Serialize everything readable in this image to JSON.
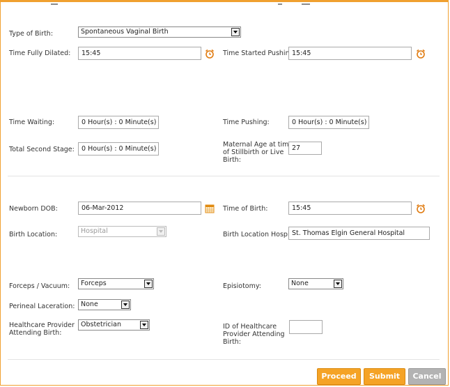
{
  "form": {
    "type_of_birth": {
      "label": "Type of Birth:",
      "value": "Spontaneous Vaginal Birth"
    },
    "time_fully_dilated": {
      "label": "Time Fully Dilated:",
      "value": "15:45"
    },
    "time_started_pushing": {
      "label": "Time Started Pushing:",
      "value": "15:45"
    },
    "time_waiting": {
      "label": "Time Waiting:",
      "value": "0 Hour(s) : 0 Minute(s)"
    },
    "time_pushing": {
      "label": "Time Pushing:",
      "value": "0 Hour(s) : 0 Minute(s)"
    },
    "total_second_stage": {
      "label": "Total Second Stage:",
      "value": "0 Hour(s) : 0 Minute(s)"
    },
    "maternal_age": {
      "label_line1": "Maternal Age at time",
      "label_line2": "of Stillbirth or Live",
      "label_line3": "Birth:",
      "value": "27"
    },
    "newborn_dob": {
      "label": "Newborn DOB:",
      "value": "06-Mar-2012"
    },
    "time_of_birth": {
      "label": "Time of Birth:",
      "value": "15:45"
    },
    "birth_location": {
      "label": "Birth Location:",
      "value": "Hospital"
    },
    "birth_location_hospital": {
      "label": "Birth Location Hospital:",
      "value": "St. Thomas Elgin General Hospital"
    },
    "forceps_vacuum": {
      "label": "Forceps / Vacuum:",
      "value": "Forceps"
    },
    "episiotomy": {
      "label": "Episiotomy:",
      "value": "None"
    },
    "perineal_laceration": {
      "label": "Perineal Laceration:",
      "value": "None"
    },
    "healthcare_provider": {
      "label_line1": "Healthcare Provider",
      "label_line2": "Attending Birth:",
      "value": "Obstetrician"
    },
    "provider_id": {
      "label_line1": "ID of Healthcare",
      "label_line2": "Provider Attending",
      "label_line3": "Birth:",
      "value": ""
    }
  },
  "buttons": {
    "proceed": "Proceed",
    "submit": "Submit",
    "cancel": "Cancel"
  },
  "colors": {
    "accent": "#f5a326",
    "frame": "#f0a030",
    "cancel": "#b3b3b3"
  }
}
